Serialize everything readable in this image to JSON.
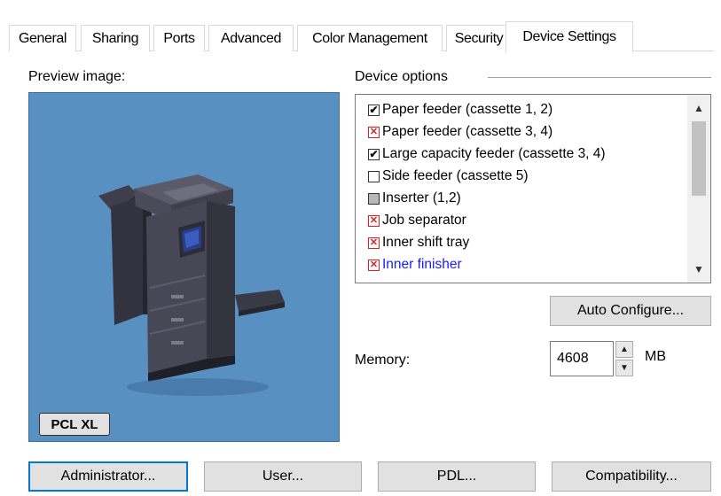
{
  "tabs": [
    {
      "label": "General"
    },
    {
      "label": "Sharing"
    },
    {
      "label": "Ports"
    },
    {
      "label": "Advanced"
    },
    {
      "label": "Color Management"
    },
    {
      "label": "Security"
    },
    {
      "label": "Device Settings",
      "selected": true
    }
  ],
  "preview": {
    "label": "Preview image:",
    "pdl_badge": "PCL XL"
  },
  "device_options": {
    "label": "Device options",
    "items": [
      {
        "label": "Paper feeder (cassette 1, 2)",
        "state": "checked"
      },
      {
        "label": "Paper feeder (cassette 3, 4)",
        "state": "unavailable"
      },
      {
        "label": "Large capacity feeder (cassette 3, 4)",
        "state": "checked"
      },
      {
        "label": "Side feeder (cassette 5)",
        "state": "unchecked"
      },
      {
        "label": "Inserter (1,2)",
        "state": "partial"
      },
      {
        "label": "Job separator",
        "state": "unavailable"
      },
      {
        "label": "Inner shift tray",
        "state": "unavailable"
      },
      {
        "label": "Inner finisher",
        "state": "unavailable",
        "highlighted": true
      }
    ]
  },
  "auto_configure_label": "Auto Configure...",
  "memory": {
    "label": "Memory:",
    "value": "4608",
    "unit": "MB"
  },
  "bottom_buttons": {
    "administrator": "Administrator...",
    "user": "User...",
    "pdl": "PDL...",
    "compatibility": "Compatibility..."
  },
  "colors": {
    "preview_background": "#5990c2",
    "unavailable_mark": "#e02020",
    "highlight_text": "#1a1aff",
    "default_button_border": "#0078d7"
  }
}
